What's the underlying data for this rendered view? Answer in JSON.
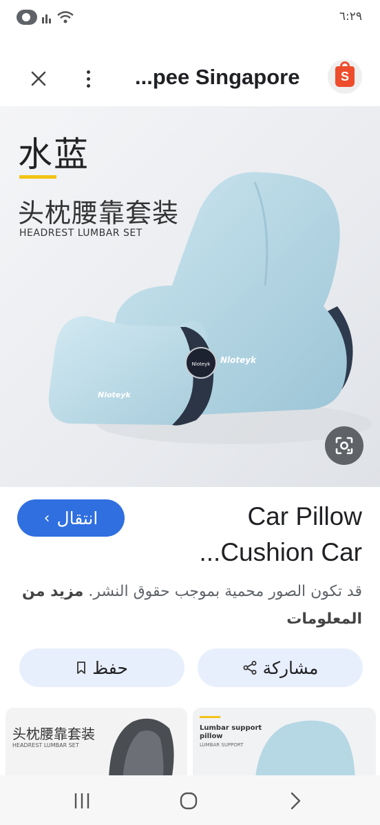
{
  "status_bar": {
    "time": "٦:٢٩",
    "icons": [
      "toggle-icon",
      "signal-icon",
      "wifi-icon"
    ]
  },
  "header": {
    "title": "...pee Singapore",
    "site_logo_letter": "S",
    "close_icon": "close-icon",
    "more_icon": "more-vert-icon"
  },
  "product_image": {
    "title_zh": "水蓝",
    "subtitle_zh": "头枕腰靠套装",
    "subtitle_en": "HEADREST LUMBAR SET",
    "brand_large": "Nloteyk",
    "brand_small": "Nloteyk",
    "badge_text": "Nloteyk",
    "lens_icon": "google-lens-icon"
  },
  "result": {
    "title_line1": "Car Pillow",
    "title_line2": "...Cushion Car",
    "visit_label": "انتقال",
    "copyright_text": "قد تكون الصور محمية بموجب حقوق النشر.",
    "learn_more": "مزيد من المعلومات",
    "share_label": "مشاركة",
    "save_label": "حفظ"
  },
  "related": {
    "left": {
      "zh": "头枕腰靠套装",
      "en": "HEADREST LUMBAR SET"
    },
    "right": {
      "line1": "Lumbar support",
      "line2": "pillow",
      "en": "LUMBAR SUPPORT"
    }
  },
  "colors": {
    "accent_blue": "#2f6fe0",
    "pill_bg": "#e8effc",
    "shopee_orange": "#ee4d2d",
    "cushion_blue": "#b9dbe8"
  }
}
